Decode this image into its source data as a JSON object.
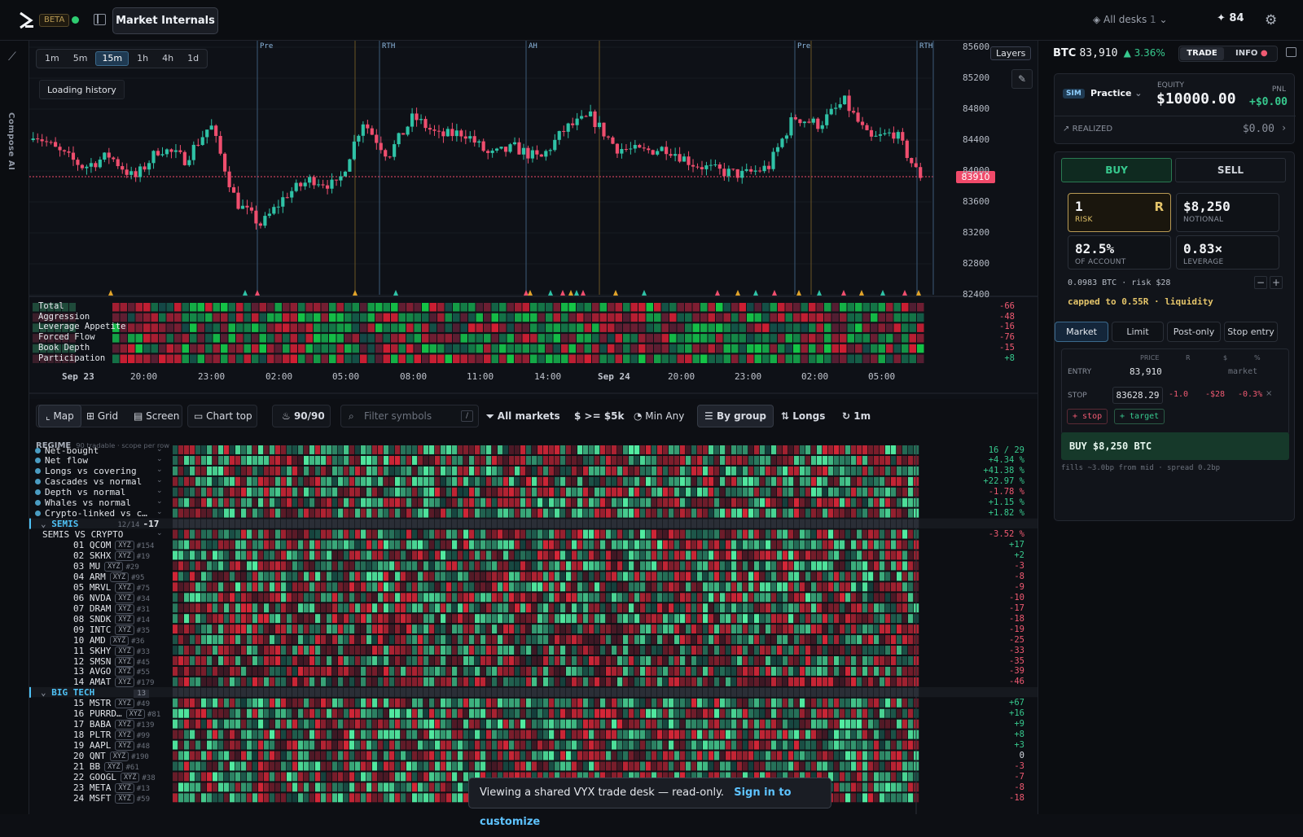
{
  "header": {
    "beta": "BETA",
    "title": "Market Internals",
    "desks": "All desks",
    "desks_count": "1",
    "score": "84"
  },
  "rail": {
    "compose": "Compose AI"
  },
  "chart": {
    "timeframes": [
      "1m",
      "5m",
      "15m",
      "1h",
      "4h",
      "1d"
    ],
    "active_timeframe": "15m",
    "loading": "Loading history",
    "layers": "Layers",
    "last_price": "83910",
    "price_levels": [
      "85600",
      "85200",
      "84800",
      "84400",
      "84000",
      "83600",
      "83200",
      "82800",
      "82400"
    ],
    "sessions": [
      {
        "label": "Pre"
      },
      {
        "label": "RTH"
      },
      {
        "label": "AH"
      },
      {
        "label": "Pre"
      },
      {
        "label": "RTH"
      }
    ],
    "x_labels": [
      "Sep 23",
      "20:00",
      "23:00",
      "02:00",
      "05:00",
      "08:00",
      "11:00",
      "14:00",
      "Sep 24",
      "20:00",
      "23:00",
      "02:00",
      "05:00"
    ],
    "heat_rows": [
      {
        "label": "Total",
        "value": "-66"
      },
      {
        "label": "Aggression",
        "value": "-48"
      },
      {
        "label": "Leverage Appetite",
        "value": "-16"
      },
      {
        "label": "Forced Flow",
        "value": "-76"
      },
      {
        "label": "Book Depth",
        "value": "-15"
      },
      {
        "label": "Participation",
        "value": "+8"
      }
    ]
  },
  "toolbar": {
    "map": "Map",
    "grid": "Grid",
    "screen": "Screen",
    "chart_top": "Chart top",
    "count": "90/90",
    "filter_placeholder": "Filter symbols",
    "slash": "/",
    "markets": "All markets",
    "min_size": "$ >= $5k",
    "min_any": "Min Any",
    "by_group": "By group",
    "longs": "Longs",
    "interval": "1m"
  },
  "heatmap": {
    "regime": "REGIME",
    "regime_note": "90 tradable · scope per row",
    "regime_rows": [
      {
        "label": "Net-bought",
        "value": "16 / 29"
      },
      {
        "label": "Net flow",
        "value": "+4.34 %"
      },
      {
        "label": "Longs vs covering",
        "value": "+41.38 %"
      },
      {
        "label": "Cascades vs normal",
        "value": "+22.97 %"
      },
      {
        "label": "Depth vs normal",
        "value": "-1.78 %"
      },
      {
        "label": "Whales vs normal",
        "value": "+1.15 %"
      },
      {
        "label": "Crypto-linked vs c…",
        "value": "+1.82 %"
      }
    ],
    "group1": {
      "name": "SEMIS",
      "count": "12/14",
      "score": "-17",
      "sub": "SEMIS VS CRYPTO",
      "sub_value": "-3.52 %"
    },
    "group1_rows": [
      {
        "n": "01",
        "sym": "QCOM",
        "rank": "#154",
        "v": "+17"
      },
      {
        "n": "02",
        "sym": "SKHX",
        "rank": "#19",
        "v": "+2"
      },
      {
        "n": "03",
        "sym": "MU",
        "rank": "#29",
        "v": "-3"
      },
      {
        "n": "04",
        "sym": "ARM",
        "rank": "#95",
        "v": "-8"
      },
      {
        "n": "05",
        "sym": "MRVL",
        "rank": "#75",
        "v": "-9"
      },
      {
        "n": "06",
        "sym": "NVDA",
        "rank": "#34",
        "v": "-10"
      },
      {
        "n": "07",
        "sym": "DRAM",
        "rank": "#31",
        "v": "-17"
      },
      {
        "n": "08",
        "sym": "SNDK",
        "rank": "#14",
        "v": "-18"
      },
      {
        "n": "09",
        "sym": "INTC",
        "rank": "#35",
        "v": "-19"
      },
      {
        "n": "10",
        "sym": "AMD",
        "rank": "#36",
        "v": "-25"
      },
      {
        "n": "11",
        "sym": "SKHY",
        "rank": "#33",
        "v": "-33"
      },
      {
        "n": "12",
        "sym": "SMSN",
        "rank": "#45",
        "v": "-35"
      },
      {
        "n": "13",
        "sym": "AVGO",
        "rank": "#55",
        "v": "-39"
      },
      {
        "n": "14",
        "sym": "AMAT",
        "rank": "#179",
        "v": "-46"
      }
    ],
    "group2": {
      "name": "BIG TECH",
      "count": "13"
    },
    "group2_rows": [
      {
        "n": "15",
        "sym": "MSTR",
        "rank": "#49",
        "v": "+67"
      },
      {
        "n": "16",
        "sym": "PURRD…",
        "rank": "#81",
        "v": "+16"
      },
      {
        "n": "17",
        "sym": "BABA",
        "rank": "#139",
        "v": "+9"
      },
      {
        "n": "18",
        "sym": "PLTR",
        "rank": "#99",
        "v": "+8"
      },
      {
        "n": "19",
        "sym": "AAPL",
        "rank": "#48",
        "v": "+3"
      },
      {
        "n": "20",
        "sym": "QNT",
        "rank": "#190",
        "v": "0"
      },
      {
        "n": "21",
        "sym": "BB",
        "rank": "#61",
        "v": "-3"
      },
      {
        "n": "22",
        "sym": "GOOGL",
        "rank": "#38",
        "v": "-7"
      },
      {
        "n": "23",
        "sym": "META",
        "rank": "#13",
        "v": "-8"
      },
      {
        "n": "24",
        "sym": "MSFT",
        "rank": "#59",
        "v": "-18"
      }
    ],
    "xyz": "XYZ"
  },
  "panel": {
    "symbol": "BTC",
    "price": "83,910",
    "change": "▲ 3.36%",
    "tab_trade": "TRADE",
    "tab_info": "INFO",
    "sim": "SIM",
    "account": "Practice",
    "equity_label": "EQUITY",
    "equity": "$10000.00",
    "pnl_label": "PNL",
    "pnl": "+$0.00",
    "realized_label": "REALIZED",
    "realized": "$0.00",
    "buy": "BUY",
    "sell": "SELL",
    "risk": "1",
    "risk_unit": "R",
    "risk_label": "RISK",
    "notional": "$8,250",
    "notional_label": "NOTIONAL",
    "account_pct": "82.5%",
    "account_label": "OF ACCOUNT",
    "leverage": "0.83×",
    "leverage_label": "LEVERAGE",
    "size_note": "0.0983 BTC · risk $28",
    "minus": "−",
    "plus": "+",
    "capped": "capped to 0.55R · liquidity",
    "order_types": [
      "Market",
      "Limit",
      "Post-only",
      "Stop entry"
    ],
    "cols": [
      "PRICE",
      "R",
      "$",
      "%"
    ],
    "entry_label": "ENTRY",
    "entry_price": "83,910",
    "entry_note": "market",
    "stop_label": "STOP",
    "stop_price": "83628.29",
    "stop_r": "-1.0",
    "stop_usd": "-$28",
    "stop_pct": "-0.3%",
    "stop_x": "×",
    "add_stop": "+ stop",
    "add_target": "+ target",
    "submit": "BUY $8,250 BTC",
    "fill_note": "fills ~3.0bp from mid · spread 0.2bp"
  },
  "toast": {
    "text": "Viewing a shared VYX trade desk — read-only.",
    "link": "Sign in to customize"
  },
  "colors": {
    "up": "#2fc2a6",
    "down": "#ef4e6e",
    "accent": "#4fc3f7",
    "buy": "#2ecc71"
  }
}
